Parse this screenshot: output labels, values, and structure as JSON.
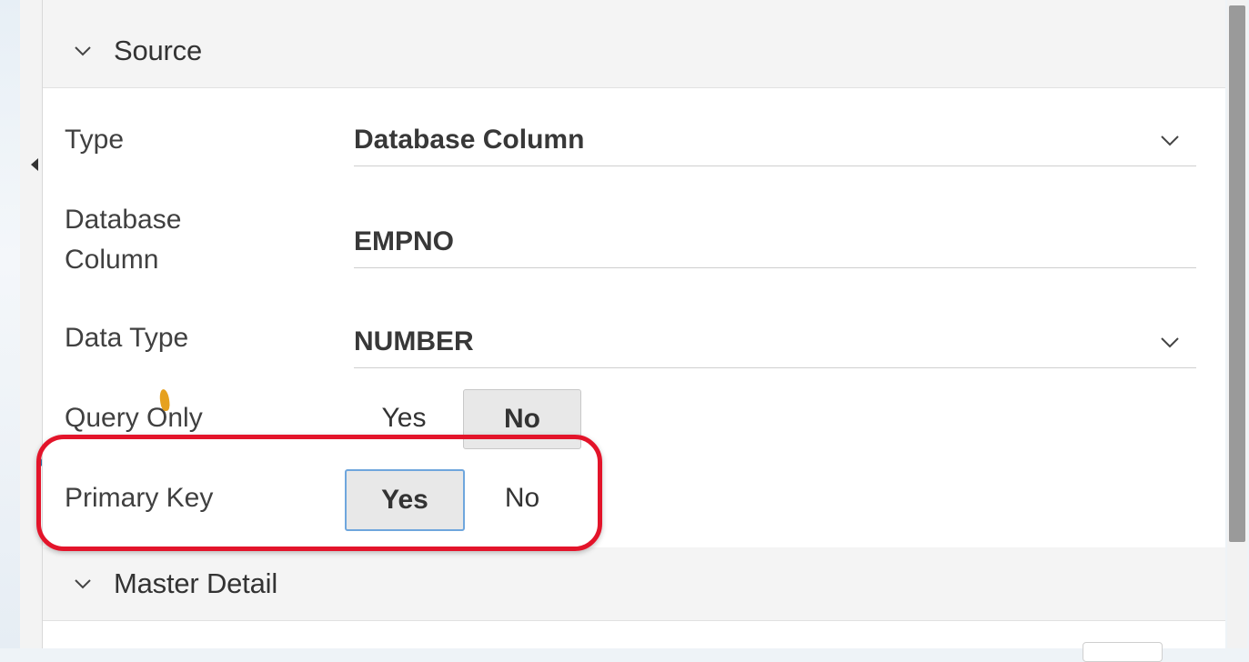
{
  "source_section": {
    "title": "Source",
    "fields": {
      "type": {
        "label": "Type",
        "value": "Database Column"
      },
      "database_column": {
        "label_line1": "Database",
        "label_line2": "Column",
        "value": "EMPNO"
      },
      "data_type": {
        "label": "Data Type",
        "value": "NUMBER"
      },
      "query_only": {
        "label": "Query Only",
        "yes": "Yes",
        "no": "No",
        "selected": "No"
      },
      "primary_key": {
        "label": "Primary Key",
        "yes": "Yes",
        "no": "No",
        "selected": "Yes"
      }
    }
  },
  "master_detail_section": {
    "title": "Master Detail"
  },
  "colors": {
    "highlight": "#e3142a",
    "focus": "#6fa6dd"
  },
  "icons": [
    "chevron-down-icon",
    "collapse-left-icon"
  ]
}
